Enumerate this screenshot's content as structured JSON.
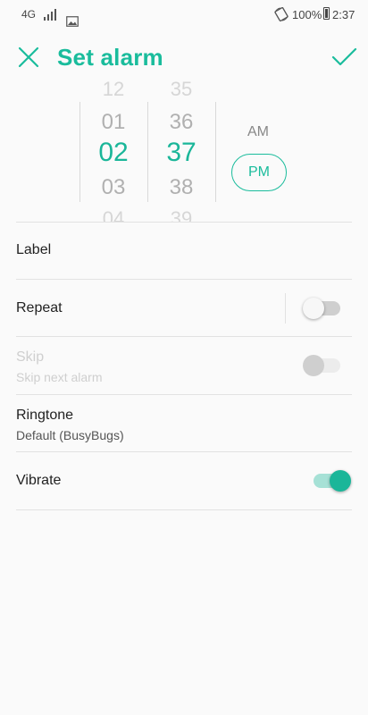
{
  "status_bar": {
    "network": "4G",
    "battery": "100%",
    "time": "2:37"
  },
  "header": {
    "title": "Set alarm"
  },
  "picker": {
    "hours": [
      "12",
      "01",
      "02",
      "03",
      "04"
    ],
    "minutes": [
      "35",
      "36",
      "37",
      "38",
      "39"
    ],
    "am_label": "AM",
    "pm_label": "PM",
    "selected_period": "PM"
  },
  "settings": {
    "label": {
      "title": "Label"
    },
    "repeat": {
      "title": "Repeat",
      "enabled": false
    },
    "skip": {
      "title": "Skip",
      "subtitle": "Skip next alarm",
      "enabled": false,
      "disabled": true
    },
    "ringtone": {
      "title": "Ringtone",
      "value": "Default (BusyBugs)"
    },
    "vibrate": {
      "title": "Vibrate",
      "enabled": true
    }
  },
  "colors": {
    "accent": "#1abc9c",
    "accent_light": "#a6e1d6"
  }
}
